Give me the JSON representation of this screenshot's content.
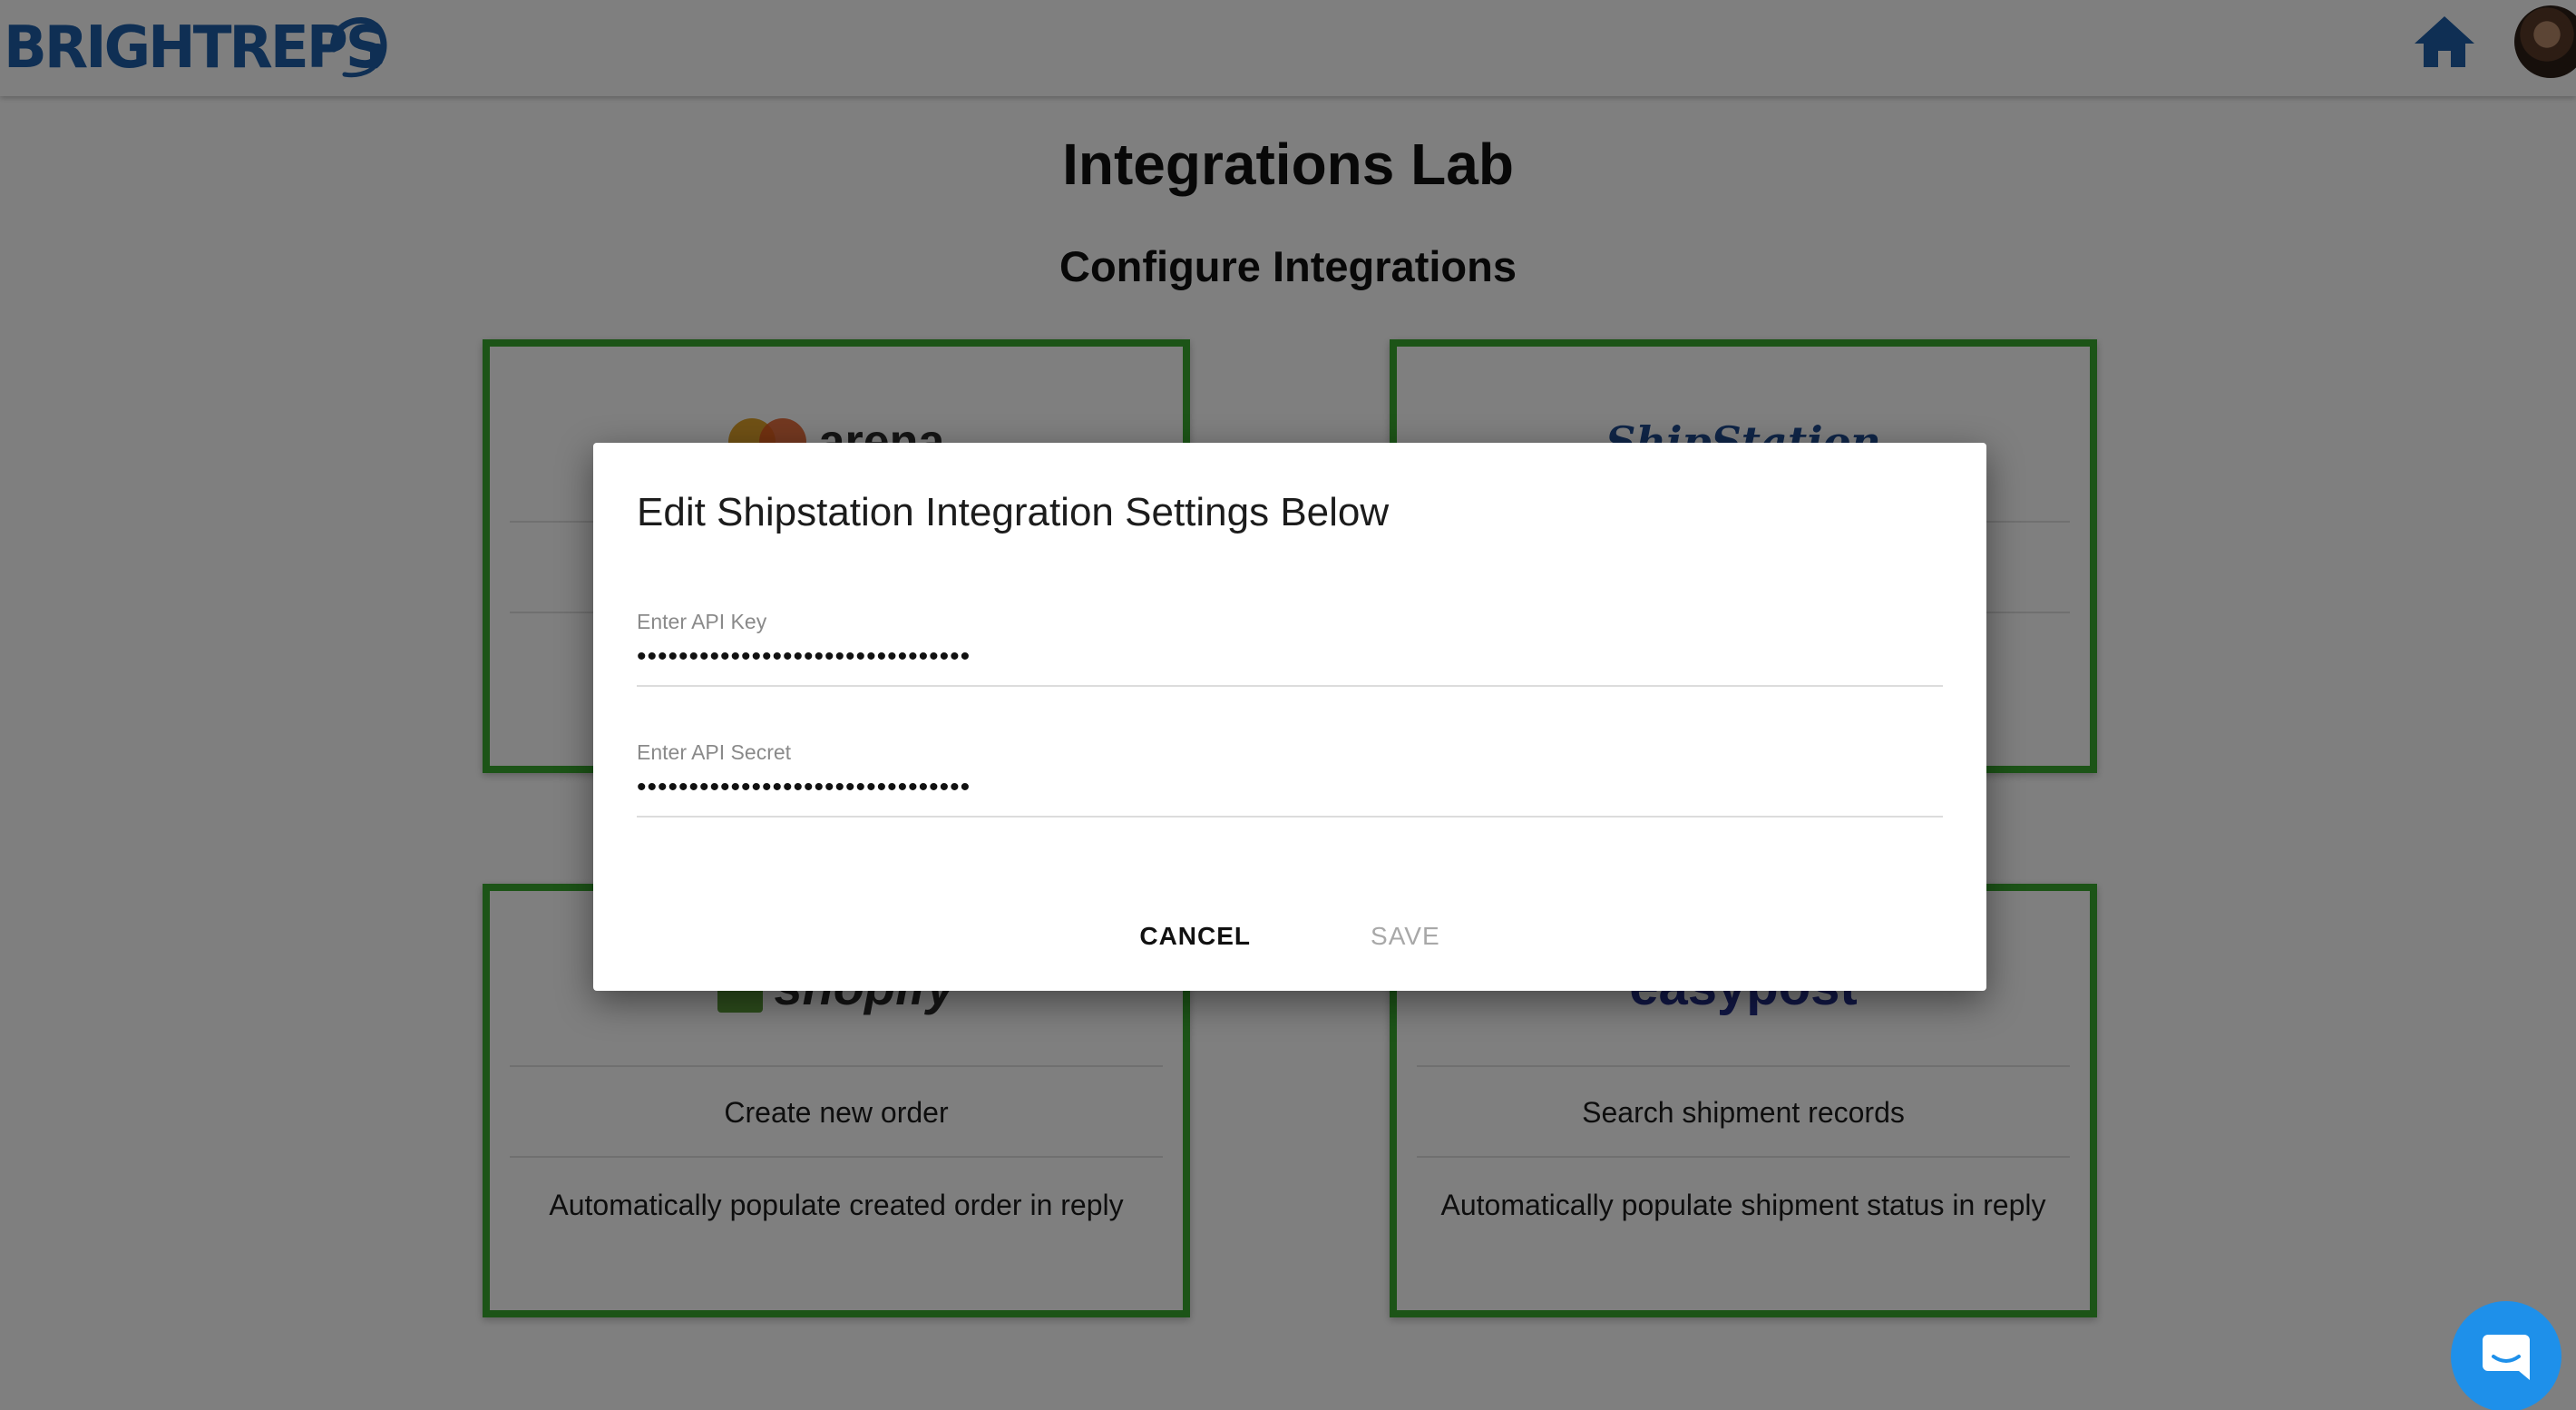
{
  "header": {
    "logo_text": "BRIGHTREPS",
    "home_icon": "home-icon",
    "avatar": "user-avatar"
  },
  "page": {
    "title": "Integrations Lab",
    "subtitle": "Configure Integrations"
  },
  "cards": [
    {
      "logo": "arena",
      "line1": "",
      "line2": ""
    },
    {
      "logo": "ShipStation",
      "line1": "",
      "line2": ""
    },
    {
      "logo": "shopify",
      "line1": "Create new order",
      "line2": "Automatically populate created order in reply"
    },
    {
      "logo": "easypost",
      "line1": "Search shipment records",
      "line2": "Automatically populate shipment status in reply"
    }
  ],
  "dialog": {
    "title": "Edit Shipstation Integration Settings Below",
    "api_key": {
      "label": "Enter API Key",
      "value": "••••••••••••••••••••••••••••••••"
    },
    "api_secret": {
      "label": "Enter API Secret",
      "value": "••••••••••••••••••••••••••••••••"
    },
    "cancel_label": "CANCEL",
    "save_label": "SAVE"
  },
  "colors": {
    "brand_blue": "#1f5fa8",
    "card_border_green": "#38a82f",
    "chat_blue": "#1e90ea",
    "overlay": "rgba(0,0,0,0.5)"
  },
  "chat": {
    "icon": "chat-bubble-icon"
  }
}
